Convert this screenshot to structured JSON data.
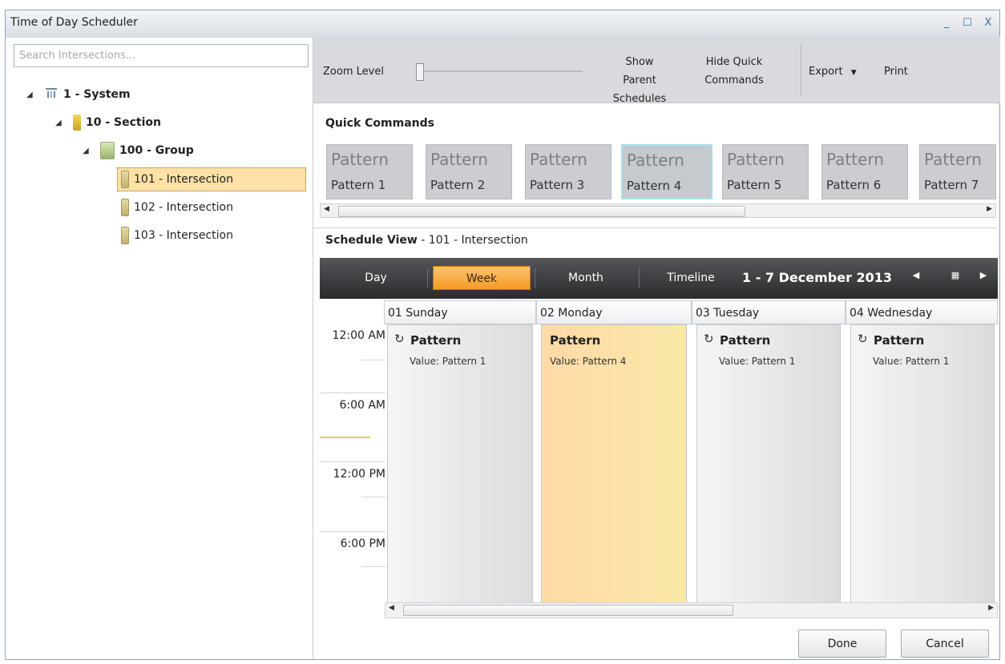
{
  "window": {
    "title": "Time of Day Scheduler",
    "controls": [
      "_",
      "☐",
      "X"
    ]
  },
  "search": {
    "placeholder": "Search Intersections..."
  },
  "tree": {
    "system": "1 - System",
    "section": "10 - Section",
    "group": "100 - Group",
    "intersections": [
      "101 - Intersection",
      "102 - Intersection",
      "103 - Intersection"
    ]
  },
  "toolbar": {
    "zoom_label": "Zoom Level",
    "show_parent_1": "Show Parent",
    "show_parent_2": "Schedules",
    "hide_quick_1": "Hide Quick",
    "hide_quick_2": "Commands",
    "export": "Export",
    "print": "Print"
  },
  "quick_commands": {
    "title": "Quick Commands",
    "buttons": [
      {
        "big": "Pattern",
        "small": "Pattern 1"
      },
      {
        "big": "Pattern",
        "small": "Pattern 2"
      },
      {
        "big": "Pattern",
        "small": "Pattern 3"
      },
      {
        "big": "Pattern",
        "small": "Pattern 4"
      },
      {
        "big": "Pattern",
        "small": "Pattern 5"
      },
      {
        "big": "Pattern",
        "small": "Pattern 6"
      },
      {
        "big": "Pattern",
        "small": "Pattern 7"
      }
    ]
  },
  "schedule_view": {
    "title": "Schedule View",
    "subtitle": " - 101 - Intersection"
  },
  "nav": {
    "views": [
      "Day",
      "Week",
      "Month",
      "Timeline"
    ],
    "active_view": "Week",
    "date_range": "1 - 7 December 2013"
  },
  "days": [
    "01 Sunday",
    "02 Monday",
    "03 Tuesday",
    "04 Wednesday"
  ],
  "times": [
    "12:00 AM",
    "6:00 AM",
    "12:00 PM",
    "6:00 PM"
  ],
  "appointments": [
    {
      "title": "Pattern",
      "value": "Value: Pattern 1",
      "recurring": true
    },
    {
      "title": "Pattern",
      "value": "Value: Pattern 4",
      "recurring": false
    },
    {
      "title": "Pattern",
      "value": "Value: Pattern 1",
      "recurring": true
    },
    {
      "title": "Pattern",
      "value": "Value: Pattern 1",
      "recurring": true
    }
  ],
  "footer": {
    "done": "Done",
    "cancel": "Cancel"
  }
}
